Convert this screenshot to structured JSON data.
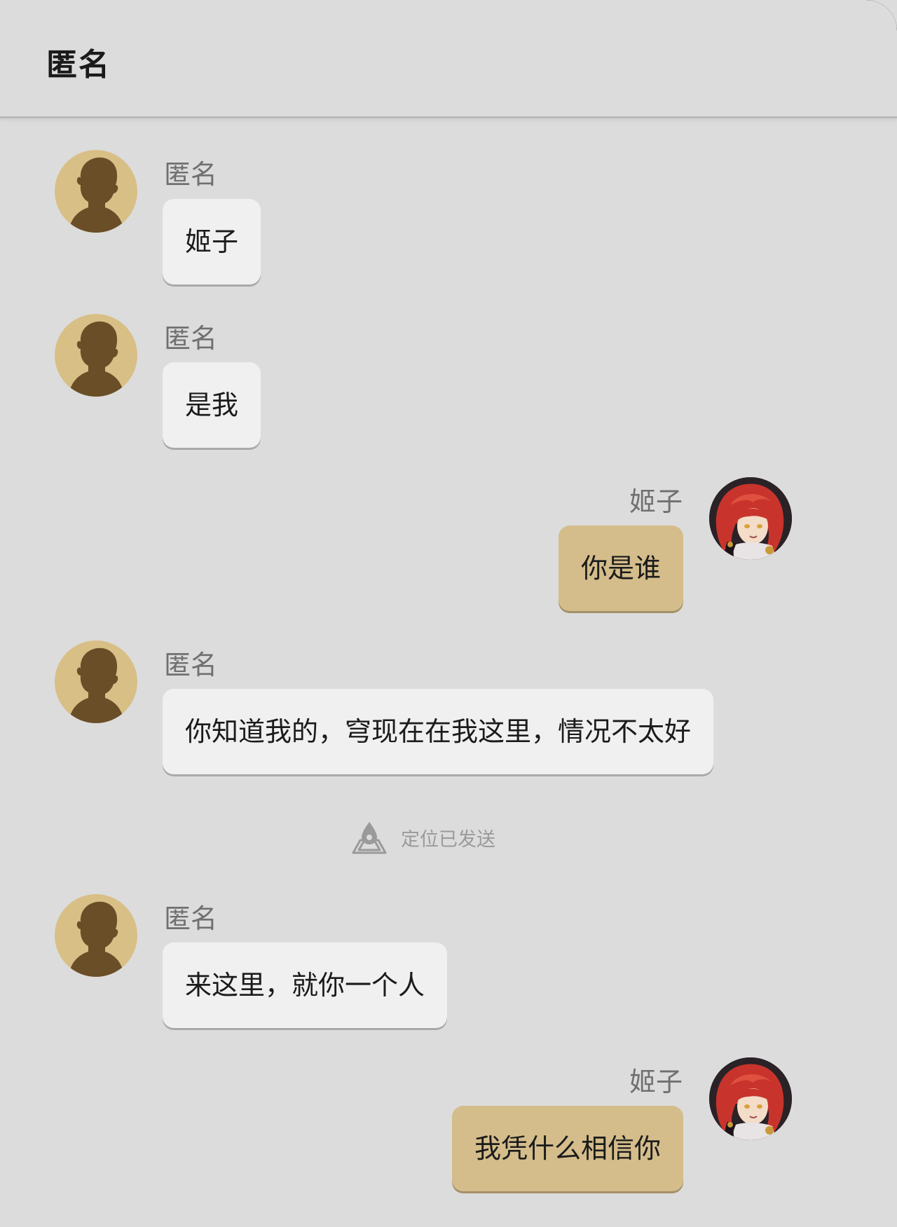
{
  "header": {
    "title": "匿名"
  },
  "messages": [
    {
      "side": "left",
      "sender": "匿名",
      "text": "姬子"
    },
    {
      "side": "left",
      "sender": "匿名",
      "text": "是我"
    },
    {
      "side": "right",
      "sender": "姬子",
      "text": "你是谁"
    },
    {
      "side": "left",
      "sender": "匿名",
      "text": "你知道我的，穹现在在我这里，情况不太好"
    },
    {
      "side": "left",
      "sender": "匿名",
      "text": "来这里，就你一个人"
    },
    {
      "side": "right",
      "sender": "姬子",
      "text": "我凭什么相信你"
    }
  ],
  "system_notice": {
    "icon": "location-pin-icon",
    "text": "定位已发送"
  },
  "colors": {
    "background": "#dcdcdc",
    "bubble_left": "#f0f0f0",
    "bubble_right": "#d4bd8b",
    "avatar_anon_bg": "#d8bf86",
    "avatar_anon_silhouette": "#6a4e28"
  }
}
